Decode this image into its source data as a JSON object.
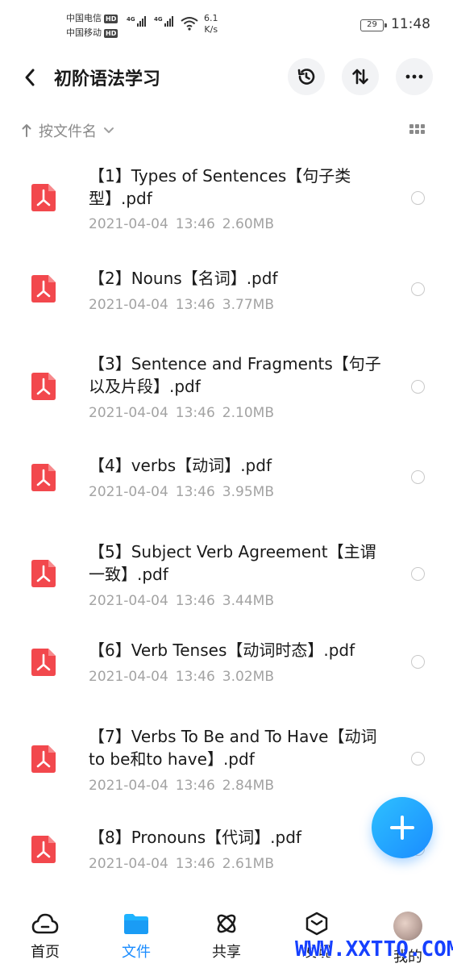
{
  "status_bar": {
    "carrier1": "中国电信",
    "carrier2": "中国移动",
    "hd": "HD",
    "net_type": "4G",
    "speed_value": "6.1",
    "speed_unit": "K/s",
    "battery": "29",
    "time": "11:48"
  },
  "header": {
    "title": "初阶语法学习",
    "icons": [
      "back-arrow",
      "history",
      "sort-swap",
      "more"
    ]
  },
  "sort": {
    "label": "按文件名",
    "direction_icon": "arrow-up"
  },
  "files": [
    {
      "name": "【1】Types of Sentences【句子类型】.pdf",
      "date": "2021-04-04",
      "time": "13:46",
      "size": "2.60MB"
    },
    {
      "name": "【2】Nouns【名词】.pdf",
      "date": "2021-04-04",
      "time": "13:46",
      "size": "3.77MB"
    },
    {
      "name": "【3】Sentence and Fragments【句子以及片段】.pdf",
      "date": "2021-04-04",
      "time": "13:46",
      "size": "2.10MB"
    },
    {
      "name": "【4】verbs【动词】.pdf",
      "date": "2021-04-04",
      "time": "13:46",
      "size": "3.95MB"
    },
    {
      "name": "【5】Subject Verb Agreement【主谓一致】.pdf",
      "date": "2021-04-04",
      "time": "13:46",
      "size": "3.44MB"
    },
    {
      "name": "【6】Verb Tenses【动词时态】.pdf",
      "date": "2021-04-04",
      "time": "13:46",
      "size": "3.02MB"
    },
    {
      "name": "【7】Verbs To Be and To Have【动词to be和to have】.pdf",
      "date": "2021-04-04",
      "time": "13:46",
      "size": "2.84MB"
    },
    {
      "name": "【8】Pronouns【代词】.pdf",
      "date": "2021-04-04",
      "time": "13:46",
      "size": "2.61MB"
    }
  ],
  "nav": {
    "home": "首页",
    "files": "文件",
    "share": "共享",
    "fourth": "发现",
    "me": "我的"
  },
  "colors": {
    "accent": "#1a8cff",
    "pdf_red": "#f2484d",
    "meta_gray": "#a3a3a3"
  },
  "watermark": "WWW.XXTTQ.COM"
}
